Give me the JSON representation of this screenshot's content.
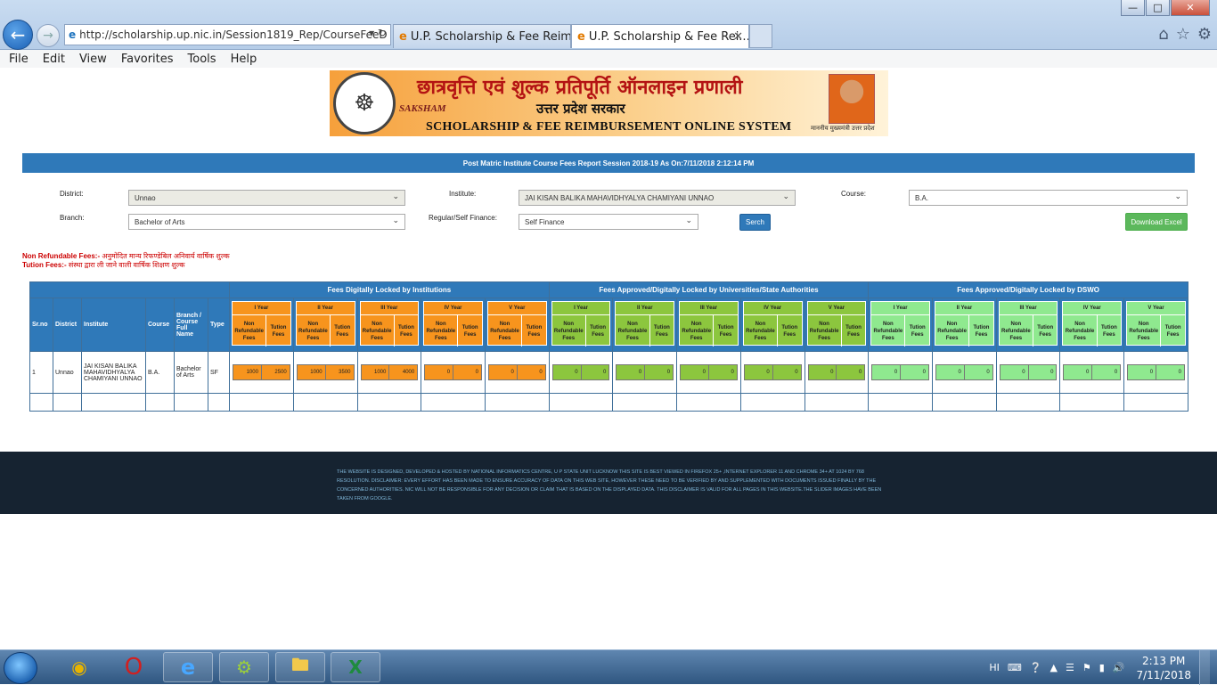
{
  "browser": {
    "url": "http://scholarship.up.nic.in/Session1819_Rep/CourseFeeD",
    "tabs": [
      {
        "title": "U.P. Scholarship & Fee Reimbu..."
      },
      {
        "title": "U.P. Scholarship & Fee Rei..."
      }
    ],
    "menu": [
      "File",
      "Edit",
      "View",
      "Favorites",
      "Tools",
      "Help"
    ]
  },
  "banner": {
    "hindi_title": "छात्रवृत्ति एवं शुल्क प्रतिपूर्ति ऑनलाइन प्रणाली",
    "saksham": "SAKSHAM",
    "state": "उत्तर प्रदेश सरकार",
    "english_title": "SCHOLARSHIP & FEE REIMBURSEMENT ONLINE SYSTEM",
    "cm_caption": "माननीय मुख्यमंत्री उत्तर प्रदेश"
  },
  "report": {
    "title": "Post Matric Institute Course Fees Report Session 2018-19 As On:7/11/2018 2:12:14 PM"
  },
  "filters": {
    "district_label": "District:",
    "district_value": "Unnao",
    "institute_label": "Institute:",
    "institute_value": "JAI KISAN BALIKA MAHAVIDHYALYA CHAMIYANI UNNAO",
    "course_label": "Course:",
    "course_value": "B.A.",
    "branch_label": "Branch:",
    "branch_value": "Bachelor of Arts",
    "finance_label": "Regular/Self Finance:",
    "finance_value": "Self Finance",
    "search_label": "Serch",
    "download_label": "Download Excel"
  },
  "notes": {
    "nonrefundable_key": "Non Refundable Fees:-",
    "nonrefundable_text": "अनुमोदित मान्य रिफण्डेबिल अनिवार्य वार्षिक शुल्क",
    "tuition_key": "Tution Fees:-",
    "tuition_text": "संस्था द्वारा ली जाने वाली वार्षिक शिक्षण शुल्क"
  },
  "table": {
    "groups": [
      "Fees Digitally Locked by Institutions",
      "Fees Approved/Digitally Locked by Universities/State Authorities",
      "Fees Approved/Digitally Locked by DSWO"
    ],
    "columns": {
      "srno": "Sr.no",
      "district": "District",
      "institute": "Institute",
      "course": "Course",
      "branch": "Branch / Course Full Name",
      "type": "Type"
    },
    "years": [
      "I Year",
      "II Year",
      "III Year",
      "IV Year",
      "V Year"
    ],
    "sub_nonrefundable": "Non Refundable Fees",
    "sub_tuition": "Tution Fees",
    "row": {
      "srno": "1",
      "district": "Unnao",
      "institute": "JAI KISAN BALIKA MAHAVIDHYALYA CHAMIYANI UNNAO",
      "course": "B.A.",
      "branch": "Bachelor of Arts",
      "type": "SF",
      "institution_fees": [
        [
          "1000",
          "2500"
        ],
        [
          "1000",
          "3500"
        ],
        [
          "1000",
          "4000"
        ],
        [
          "0",
          "0"
        ],
        [
          "0",
          "0"
        ]
      ],
      "university_fees": [
        [
          "0",
          "0"
        ],
        [
          "0",
          "0"
        ],
        [
          "0",
          "0"
        ],
        [
          "0",
          "0"
        ],
        [
          "0",
          "0"
        ]
      ],
      "dswo_fees": [
        [
          "0",
          "0"
        ],
        [
          "0",
          "0"
        ],
        [
          "0",
          "0"
        ],
        [
          "0",
          "0"
        ],
        [
          "0",
          "0"
        ]
      ]
    }
  },
  "footer": {
    "text": "THE WEBSITE IS DESIGNED, DEVELOPED & HOSTED BY NATIONAL INFORMATICS CENTRE, U P STATE UNIT LUCKNOW THIS SITE IS BEST VIEWED IN FIREFOX 25+ ,INTERNET EXPLORER 11 AND CHROME 34+ AT 1024 BY 768 RESOLUTION. DISCLAIMER: EVERY EFFORT HAS BEEN MADE TO ENSURE ACCURACY OF DATA ON THIS WEB SITE, HOWEVER THESE NEED TO BE VERIFIED BY AND SUPPLEMENTED WITH DOCUMENTS ISSUED FINALLY BY THE CONCERNED AUTHORITIES. NIC WILL NOT BE RESPONSIBLE FOR ANY DECISION OR CLAIM THAT IS BASED ON THE DISPLAYED DATA. THIS DISCLAIMER IS VALID FOR ALL PAGES IN THIS WEBSITE.THE SLIDER IMAGES HAVE BEEN TAKEN FROM GOOGLE."
  },
  "taskbar": {
    "language": "HI",
    "time": "2:13 PM",
    "date": "7/11/2018",
    "icons": [
      "chrome-icon",
      "opera-icon",
      "internet-explorer-icon",
      "setup-icon",
      "file-explorer-icon",
      "excel-icon"
    ]
  },
  "colors": {
    "header_blue": "#2f79b9",
    "institution_orange": "#f7941d",
    "university_green": "#8cc63e",
    "dswo_light_green": "#8fe98f",
    "footer_dark": "#162331",
    "excel_green": "#5cb85c"
  }
}
